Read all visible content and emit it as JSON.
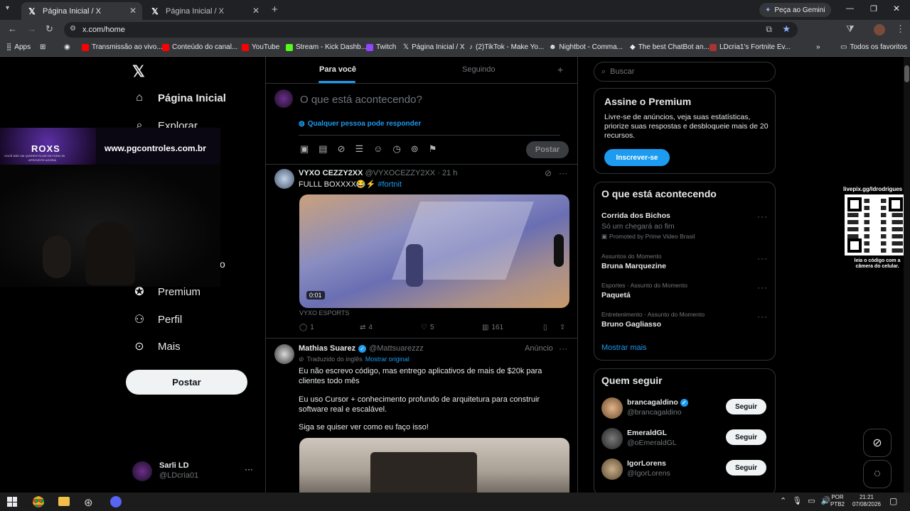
{
  "browser": {
    "tabs": [
      {
        "label": "Página Inicial / X",
        "active": true
      },
      {
        "label": "Página Inicial / X",
        "active": false
      }
    ],
    "gemini_button": "Peça ao Gemini",
    "url": "x.com/home",
    "bookmarks": [
      "Apps",
      "Transmissão ao vivo...",
      "Conteúdo do canal...",
      "YouTube",
      "Stream - Kick Dashb...",
      "Twitch",
      "Página Inicial / X",
      "(2)TikTok - Make Yo...",
      "Nightbot - Comma...",
      "The best ChatBot an...",
      "LDcria1's Fortnite Ev..."
    ],
    "all_favorites": "Todos os favoritos"
  },
  "overlay": {
    "roxs_title": "ROXS",
    "roxs_tagline": "VOCÊ NÃO VAI QUERER FICAR DE FORA! 50",
    "roxs_tagline2": "APROVEITE AGORA!",
    "website": "www.pgcontroles.com.br",
    "qr_url": "livepix.gg/ldrodrigues",
    "qr_caption": "leia o código com a câmera do celular."
  },
  "nav": {
    "items": [
      {
        "label": "Página Inicial",
        "icon": "home-icon"
      },
      {
        "label": "Explorar",
        "icon": "search-icon"
      },
      {
        "label": "Premium",
        "icon": "premium-icon"
      },
      {
        "label": "Perfil",
        "icon": "person-icon"
      },
      {
        "label": "Mais",
        "icon": "more-icon"
      }
    ],
    "hidden_letter": "o",
    "post_button": "Postar",
    "user": {
      "name": "Sarli LD",
      "handle": "@LDcria01"
    }
  },
  "feed": {
    "tabs": [
      "Para você",
      "Seguindo"
    ],
    "composer": {
      "placeholder": "O que está acontecendo?",
      "reply_setting": "Qualquer pessoa pode responder",
      "post_button": "Postar"
    },
    "tweet1": {
      "name": "VYXO CEZZY2XX",
      "handle": "@VYXOCEZZY2XX",
      "time": "21 h",
      "text": "FULLL BOXXXX😂⚡",
      "hashtag": "#fortnit",
      "video_time": "0:01",
      "source": "VYXO ESPORTS",
      "replies": "1",
      "retweets": "4",
      "likes": "5",
      "views": "161"
    },
    "tweet2": {
      "name": "Mathias Suarez",
      "handle": "@Mattsuarezzz",
      "ad_label": "Anúncio",
      "translated": "Traduzido do inglês",
      "show_original": "Mostrar original",
      "para1": "Eu não escrevo código, mas entrego aplicativos de mais de $20k para clientes todo mês",
      "para2": "Eu uso Cursor + conhecimento profundo de arquitetura para construir software real e escalável.",
      "para3": "Siga se quiser ver como eu faço isso!"
    }
  },
  "sidebar": {
    "search_placeholder": "Buscar",
    "premium": {
      "title": "Assine o Premium",
      "text": "Livre-se de anúncios, veja suas estatísticas, priorize suas respostas e desbloqueie mais de 20 recursos.",
      "button": "Inscrever-se"
    },
    "trends": {
      "title": "O que está acontecendo",
      "items": [
        {
          "context": "",
          "name": "Corrida dos Bichos",
          "sub": "Só um chegará ao fim",
          "promo": "Promoted by Prime Video Brasil"
        },
        {
          "context": "Assuntos do Momento",
          "name": "Bruna Marquezine"
        },
        {
          "context": "Esportes · Assunto do Momento",
          "name": "Paquetá"
        },
        {
          "context": "Entretenimento · Assunto do Momento",
          "name": "Bruno Gagliasso"
        }
      ],
      "show_more": "Mostrar mais"
    },
    "who_to_follow": {
      "title": "Quem seguir",
      "items": [
        {
          "name": "brancagaldino",
          "handle": "@brancagaldino",
          "verified": true,
          "button": "Seguir"
        },
        {
          "name": "EmeraldGL",
          "handle": "@oEmeraldGL",
          "verified": false,
          "button": "Seguir"
        },
        {
          "name": "IgorLorens",
          "handle": "@IgorLorens",
          "verified": false,
          "button": "Seguir"
        }
      ]
    }
  },
  "taskbar": {
    "lang": "POR",
    "layout": "PTB2",
    "time": "21:21",
    "date": "07/08/2026"
  },
  "colors": {
    "accent": "#1d9bf0",
    "bg": "#000000",
    "border": "#2f3336"
  }
}
